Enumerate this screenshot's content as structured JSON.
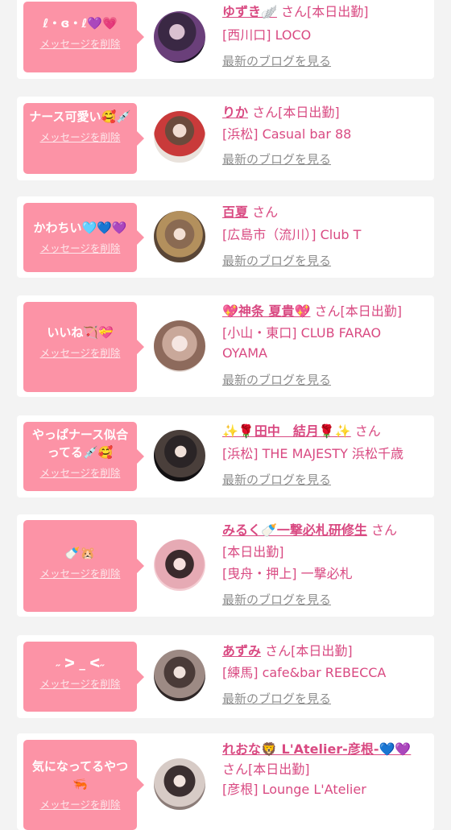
{
  "common": {
    "san": "さん",
    "delete_label": "メッセージを削除",
    "blog_link": "最新のブログを見る",
    "accent_color": "#fc93a6",
    "name_color": "#d94a82"
  },
  "cards": [
    {
      "message": "ℓ・ɞ・ℓ💜💗",
      "name": "ゆずき🪽",
      "badge": "[本日出勤]",
      "shop": "[西川口] LOCO"
    },
    {
      "message": "ナース可愛い🥰💉",
      "name": "りか",
      "badge": "[本日出勤]",
      "shop": "[浜松] Casual bar 88"
    },
    {
      "message": "かわちい🩵💙💜",
      "name": "百夏",
      "badge": "",
      "shop": "[広島市（流川）] Club T"
    },
    {
      "message": "いいね🏹💝",
      "name": "💖神条 夏貴💖",
      "badge": "[本日出勤]",
      "shop": "[小山・東口] CLUB FARAO OYAMA"
    },
    {
      "message": "やっぱナース似合ってる💉🥰",
      "name": "✨🌹田中　結月🌹✨",
      "badge": "",
      "shop": "[浜松] THE MAJESTY 浜松千歳"
    },
    {
      "message": "🍼🐹",
      "name": "みるく🍼一撃必札研修生",
      "badge": "[本日出勤]",
      "shop": "[曳舟・押上] 一撃必札"
    },
    {
      "message": "˶ ᐳ _ ᐸ˶",
      "name": "あずみ",
      "badge": "[本日出勤]",
      "shop": "[練馬] cafe&bar REBECCA"
    },
    {
      "message": "気になってるやつ🦐",
      "name": "れおな🦁 L'Atelier-彦根-💙💜",
      "badge": "[本日出勤]",
      "shop": "[彦根] Lounge L'Atelier"
    }
  ]
}
